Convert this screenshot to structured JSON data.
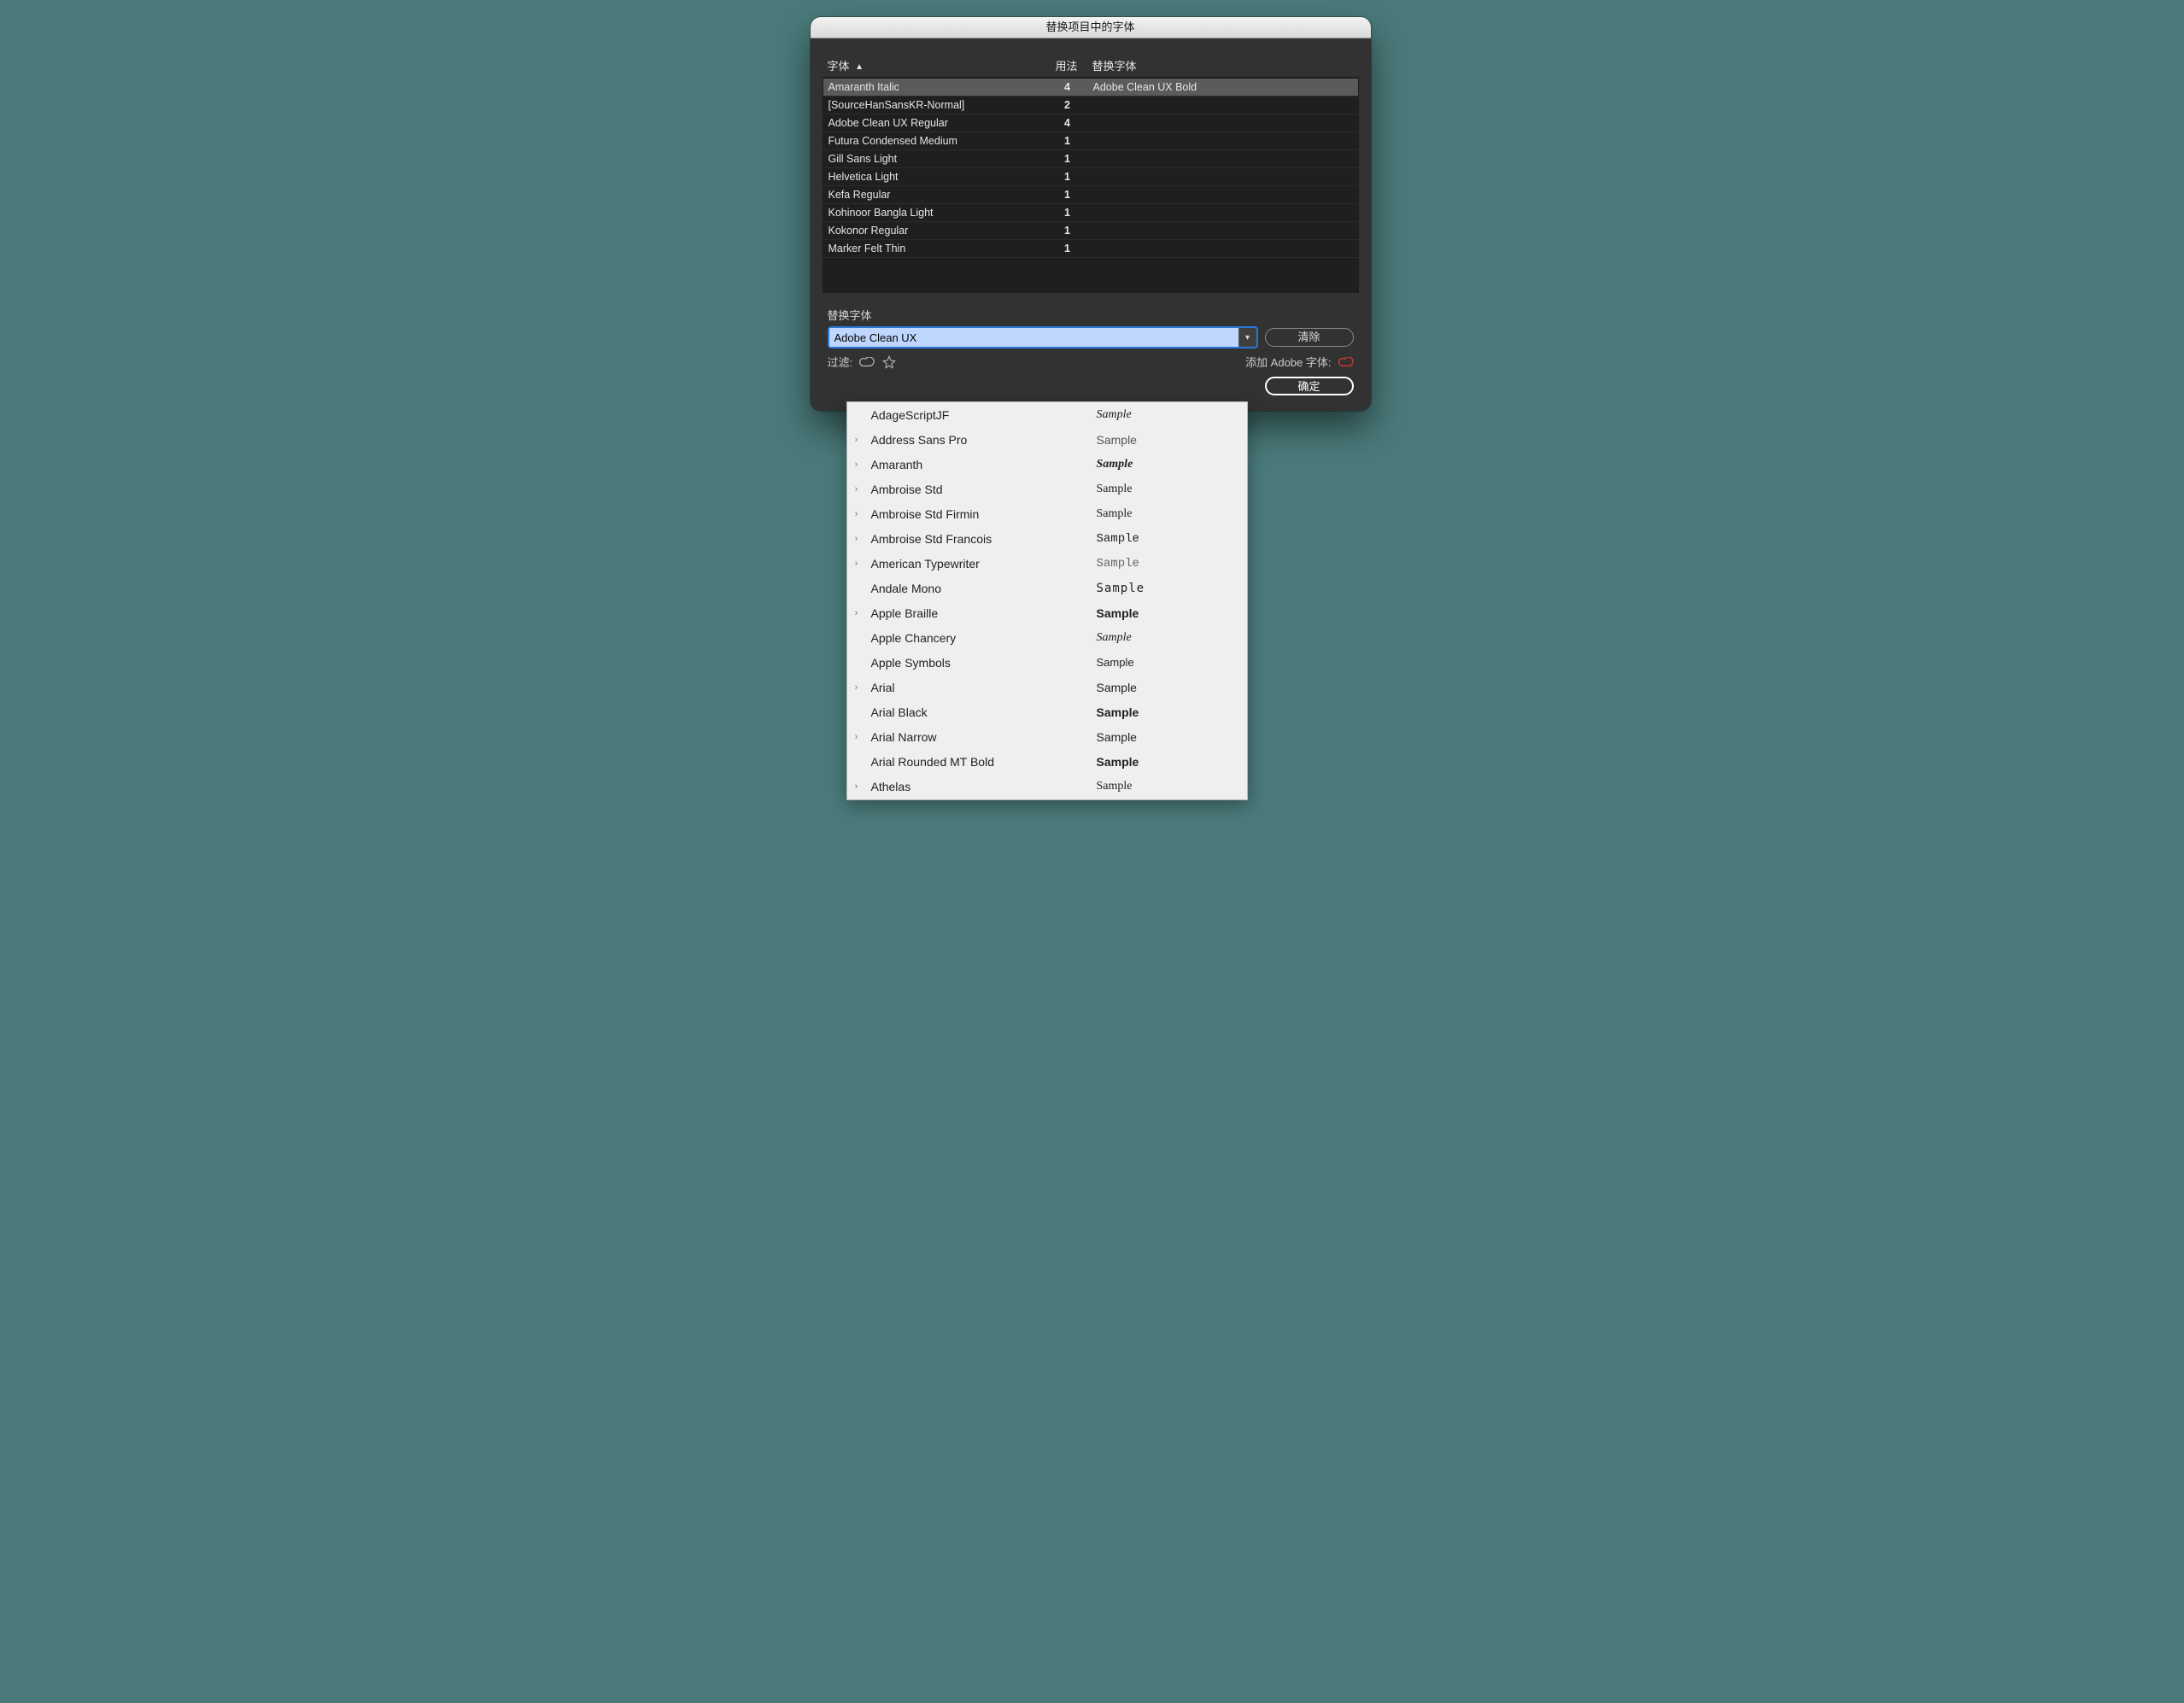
{
  "dialog": {
    "title": "替换项目中的字体",
    "columns": {
      "font": "字体",
      "usage": "用法",
      "replace": "替换字体"
    },
    "rows": [
      {
        "font": "Amaranth Italic",
        "usage": "4",
        "replace": "Adobe Clean UX Bold",
        "selected": true
      },
      {
        "font": "[SourceHanSansKR-Normal]",
        "usage": "2",
        "replace": ""
      },
      {
        "font": "Adobe Clean UX Regular",
        "usage": "4",
        "replace": ""
      },
      {
        "font": "Futura Condensed Medium",
        "usage": "1",
        "replace": ""
      },
      {
        "font": "Gill Sans Light",
        "usage": "1",
        "replace": ""
      },
      {
        "font": "Helvetica Light",
        "usage": "1",
        "replace": ""
      },
      {
        "font": "Kefa Regular",
        "usage": "1",
        "replace": ""
      },
      {
        "font": "Kohinoor Bangla Light",
        "usage": "1",
        "replace": ""
      },
      {
        "font": "Kokonor Regular",
        "usage": "1",
        "replace": ""
      },
      {
        "font": "Marker Felt Thin",
        "usage": "1",
        "replace": ""
      }
    ],
    "replace_section_label": "替换字体",
    "combo_value": "Adobe Clean UX",
    "clear_label": "清除",
    "filter_label": "过滤:",
    "add_adobe_label": "添加 Adobe 字体:",
    "ok_label": "确定"
  },
  "dropdown": {
    "sample_word": "Sample",
    "items": [
      {
        "name": "AdageScriptJF",
        "expandable": false,
        "style": "s-script"
      },
      {
        "name": "Address Sans Pro",
        "expandable": true,
        "style": "s-sans"
      },
      {
        "name": "Amaranth",
        "expandable": true,
        "style": "s-bi"
      },
      {
        "name": "Ambroise Std",
        "expandable": true,
        "style": "s-didone"
      },
      {
        "name": "Ambroise Std Firmin",
        "expandable": true,
        "style": "s-didone2"
      },
      {
        "name": "Ambroise Std Francois",
        "expandable": true,
        "style": "s-slab"
      },
      {
        "name": "American Typewriter",
        "expandable": true,
        "style": "s-type"
      },
      {
        "name": "Andale Mono",
        "expandable": false,
        "style": "s-mono"
      },
      {
        "name": "Apple Braille",
        "expandable": true,
        "style": "s-bold"
      },
      {
        "name": "Apple Chancery",
        "expandable": false,
        "style": "s-it"
      },
      {
        "name": "Apple Symbols",
        "expandable": false,
        "style": "s-small"
      },
      {
        "name": "Arial",
        "expandable": true,
        "style": "s-arial"
      },
      {
        "name": "Arial Black",
        "expandable": false,
        "style": "s-black"
      },
      {
        "name": "Arial Narrow",
        "expandable": true,
        "style": "s-narrow"
      },
      {
        "name": "Arial Rounded MT Bold",
        "expandable": false,
        "style": "s-round"
      },
      {
        "name": "Athelas",
        "expandable": true,
        "style": "s-serif"
      }
    ]
  }
}
